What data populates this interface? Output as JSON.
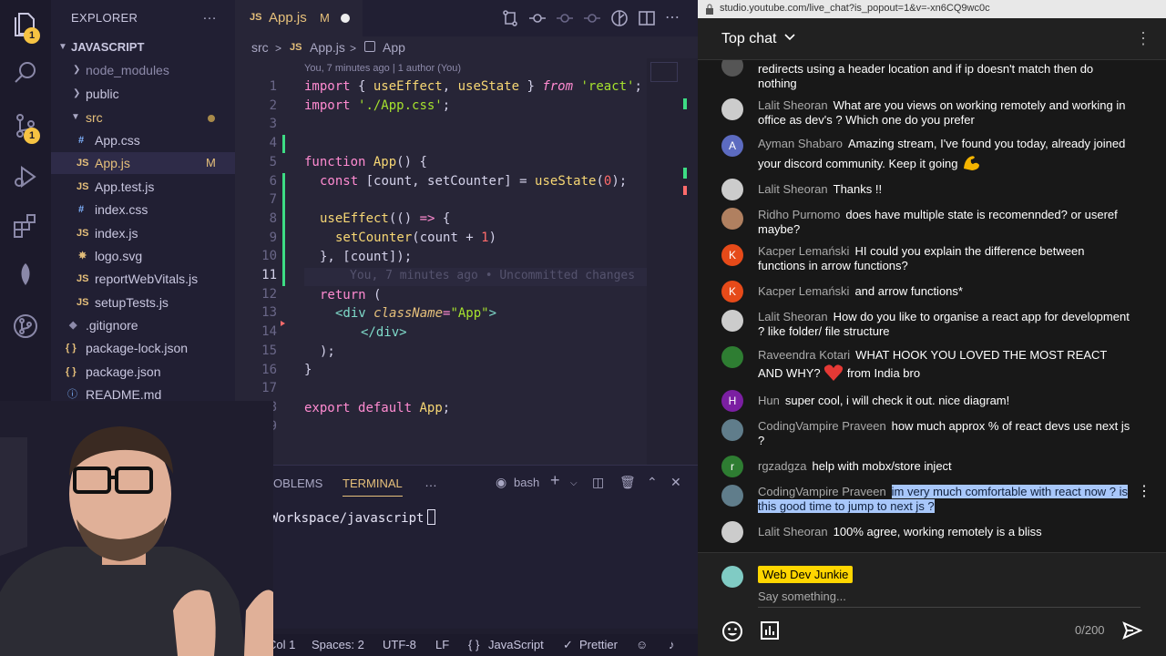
{
  "vscode": {
    "activity_icons": [
      "files-icon",
      "search-icon",
      "source-control-icon",
      "run-debug-icon",
      "extensions-icon",
      "leaf-icon",
      "git-graph-icon"
    ],
    "badges": {
      "files": "1",
      "source_control": "1"
    },
    "explorer": {
      "title": "EXPLORER",
      "menu": "…",
      "root": "JAVASCRIPT",
      "items": [
        {
          "label": "node_modules"
        },
        {
          "label": "public"
        },
        {
          "label": "src"
        },
        {
          "label": "App.css",
          "icon": "#"
        },
        {
          "label": "App.js",
          "icon": "JS",
          "badge": "M"
        },
        {
          "label": "App.test.js",
          "icon": "JS"
        },
        {
          "label": "index.css",
          "icon": "#"
        },
        {
          "label": "index.js",
          "icon": "JS"
        },
        {
          "label": "logo.svg",
          "icon": "✵"
        },
        {
          "label": "reportWebVitals.js",
          "icon": "JS"
        },
        {
          "label": "setupTests.js",
          "icon": "JS"
        },
        {
          "label": ".gitignore",
          "icon": "◆"
        },
        {
          "label": "package-lock.json",
          "icon": "{ }"
        },
        {
          "label": "package.json",
          "icon": "{ }"
        },
        {
          "label": "README.md",
          "icon": "ⓘ"
        }
      ]
    },
    "tab": {
      "type": "JS",
      "name": "App.js",
      "status": "M"
    },
    "breadcrumb": {
      "folder": "src",
      "sep": ">",
      "file_type": "JS",
      "file": "App.js",
      "symbol": "App"
    },
    "blame_header": "You, 7 minutes ago | 1 author (You)",
    "line_numbers": [
      "1",
      "2",
      "3",
      "4",
      "5",
      "6",
      "7",
      "8",
      "9",
      "10",
      "11",
      "12",
      "13",
      "14",
      "15",
      "16",
      "17",
      "18",
      "19"
    ],
    "code": {
      "l1": [
        "import",
        "{ ",
        "useEffect",
        ", ",
        "useState",
        " } ",
        "from",
        " ",
        "'react'",
        ";"
      ],
      "l2": [
        "import",
        " ",
        "'./App.css'",
        ";"
      ],
      "l5": [
        "function",
        " ",
        "App",
        "() {"
      ],
      "l6": [
        "const",
        " [count, setCounter] = ",
        "useState",
        "(",
        "0",
        ");"
      ],
      "l8": [
        "useEffect",
        "(() ",
        "=>",
        " {"
      ],
      "l9": [
        "setCounter",
        "(count + ",
        "1",
        ")"
      ],
      "l10": "}, [count]);",
      "l11_ghost": "You, 7 minutes ago • Uncommitted changes",
      "l12": [
        "return",
        " ("
      ],
      "l13": [
        "<div",
        " ",
        "className",
        "=",
        "\"App\"",
        ">"
      ],
      "l14": "</div>",
      "l15": ");",
      "l16": "}",
      "l18": [
        "export",
        " ",
        "default",
        " ",
        "App",
        ";"
      ]
    },
    "panel": {
      "tabs": [
        "PROBLEMS",
        "TERMINAL"
      ],
      "more": "…",
      "shell": "bash",
      "prompt": "~/Workspace/javascript"
    },
    "status": {
      "col": "Col 1",
      "spaces": "Spaces: 2",
      "encoding": "UTF-8",
      "eol": "LF",
      "braces": "{ }",
      "language": "JavaScript",
      "prettier": "Prettier"
    }
  },
  "youtube": {
    "url": "studio.youtube.com/live_chat?is_popout=1&v=-xn6CQ9wc0c",
    "header": {
      "title": "Top chat"
    },
    "messages": [
      {
        "author": "",
        "text": "redirects using a header location and if ip doesn't match then do nothing",
        "avatar": "",
        "avatar_color": "#555555"
      },
      {
        "author": "Lalit Sheoran",
        "text": "What are you views on working remotely and working in office as dev's ? Which one do you prefer",
        "avatar": "",
        "avatar_color": "#cccccc"
      },
      {
        "author": "Ayman Shabaro",
        "text": "Amazing stream, I've found you today, already joined your discord community. Keep it going",
        "avatar": "A",
        "avatar_color": "#5c6bc0",
        "emoji": "flexed-biceps"
      },
      {
        "author": "Lalit Sheoran",
        "text": "Thanks !!",
        "avatar": "",
        "avatar_color": "#cccccc"
      },
      {
        "author": "Ridho Purnomo",
        "text": "does have multiple state is recomennded? or useref maybe?",
        "avatar": "",
        "avatar_color": "#b08060"
      },
      {
        "author": "Kacper Lemański",
        "text": "HI could you explain the difference between functions in arrow functions?",
        "avatar": "K",
        "avatar_color": "#e64a19"
      },
      {
        "author": "Kacper Lemański",
        "text": "and arrow functions*",
        "avatar": "K",
        "avatar_color": "#e64a19"
      },
      {
        "author": "Lalit Sheoran",
        "text": "How do you like to organise a react app for development ? like folder/ file structure",
        "avatar": "",
        "avatar_color": "#cccccc"
      },
      {
        "author": "Raveendra Kotari",
        "text": "WHAT HOOK YOU LOVED THE MOST REACT AND WHY?",
        "text_after": "from India bro",
        "avatar": "",
        "avatar_color": "#2e7d32",
        "emoji": "red-heart"
      },
      {
        "author": "Hun",
        "text": "super cool, i will check it out. nice diagram!",
        "avatar": "H",
        "avatar_color": "#7b1fa2"
      },
      {
        "author": "CodingVampire Praveen",
        "text": "how much approx % of react devs use next js ?",
        "avatar": "",
        "avatar_color": "#607d8b"
      },
      {
        "author": "rgzadgza",
        "text": "help with mobx/store inject",
        "avatar": "r",
        "avatar_color": "#2e7d32"
      },
      {
        "author": "CodingVampire Praveen",
        "text": "im very much comfortable with react now ? is this good time to jump to next js ?",
        "avatar": "",
        "avatar_color": "#607d8b",
        "highlight": true
      },
      {
        "author": "Lalit Sheoran",
        "text": "100% agree, working remotely is a bliss",
        "avatar": "",
        "avatar_color": "#cccccc"
      }
    ],
    "composer": {
      "user": "Web Dev Junkie",
      "placeholder": "Say something...",
      "counter": "0/200"
    },
    "colors": {
      "background": "#181818",
      "author": "#aaaaaa",
      "highlight": "#a8c7fa",
      "user_badge": "#ffd600"
    }
  }
}
